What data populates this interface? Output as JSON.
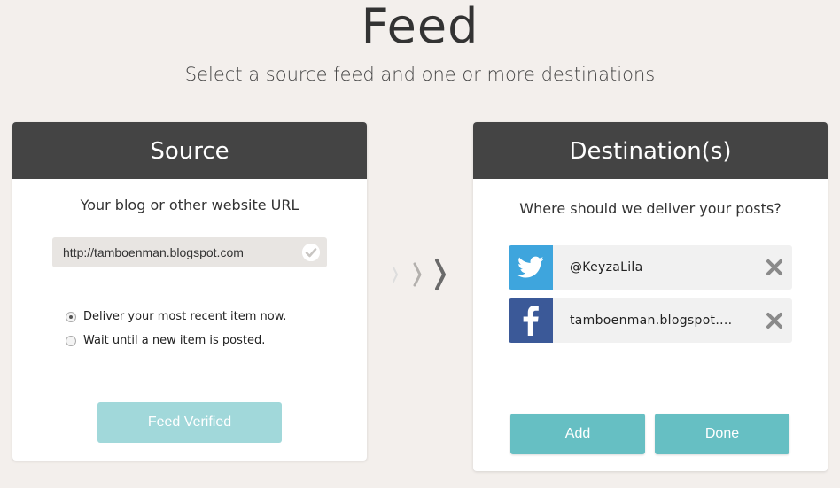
{
  "page": {
    "title": "Feed",
    "subtitle": "Select a source feed and one or more destinations"
  },
  "source": {
    "header": "Source",
    "url_label": "Your blog or other website URL",
    "url_value": "http://tamboenman.blogspot.com",
    "verified_icon": "check-circle-icon",
    "options": [
      {
        "label": "Deliver your most recent item now.",
        "checked": true
      },
      {
        "label": "Wait until a new item is posted.",
        "checked": false
      }
    ],
    "button_label": "Feed Verified"
  },
  "arrows_icon": "chevron-right-icon",
  "destination": {
    "header": "Destination(s)",
    "prompt": "Where should we deliver your posts?",
    "items": [
      {
        "service": "twitter",
        "icon": "twitter-icon",
        "name": "@KeyzaLila",
        "color": "#3ea5dd"
      },
      {
        "service": "facebook",
        "icon": "facebook-icon",
        "name": "tamboenman.blogspot....",
        "color": "#3b5998"
      }
    ],
    "add_label": "Add",
    "done_label": "Done"
  },
  "colors": {
    "background": "#f3efec",
    "header": "#444444",
    "accent": "#66bfc3",
    "accent_light": "#a1d8da"
  }
}
